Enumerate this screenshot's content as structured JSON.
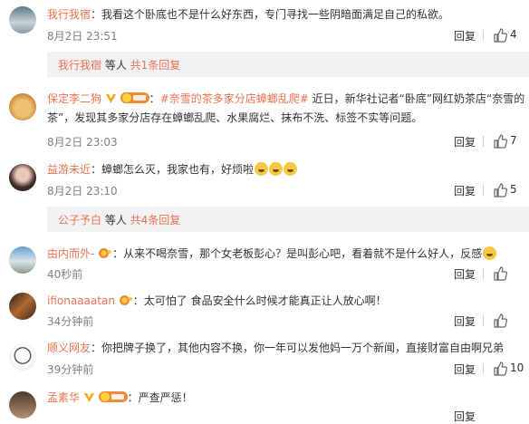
{
  "comments": [
    {
      "user": "我行我宿",
      "text": "：我看这个卧底也不是什么好东西，专门寻找一些阴暗面满足自己的私欲。",
      "time": "8月2日 23:51",
      "reply": "回复",
      "likes": "4",
      "sub": {
        "user": "我行我宿",
        "text": " 等人 ",
        "link": "共1条回复"
      }
    },
    {
      "user": "保定李二狗",
      "hashtag": "#奈雪的茶多家分店蟑螂乱爬#",
      "text1": " 近日，新华社记者“卧底”网红奶茶店“奈雪的",
      "text2": "茶”，发现其多家分店存在蟑螂乱爬、水果腐烂、抹布不洗、标签不实等问题。",
      "time": "8月2日 23:03",
      "reply": "回复",
      "likes": "7"
    },
    {
      "user": "益游未近",
      "text": "：蟑螂怎么灭，我家也有，好烦啦",
      "time": "8月2日 23:10",
      "reply": "回复",
      "likes": "5",
      "sub": {
        "user": "公子予白",
        "text": " 等人 ",
        "link": "共4条回复"
      }
    },
    {
      "user": "由内而外-",
      "text": "：从来不喝奈雪，那个女老板彭心？是叫彭心吧，看着就不是什么好人，反感",
      "time": "40秒前",
      "reply": "回复",
      "likes": ""
    },
    {
      "user": "ifionaaaatan",
      "text": "：太可怕了 食品安全什么时候才能真正让人放心啊！",
      "time": "34分钟前",
      "reply": "回复",
      "likes": ""
    },
    {
      "user": "顺义网友",
      "text": "：你把牌子换了，其他内容不换，你一年可以发他妈一万个新闻，直接财富自由啊兄弟",
      "time": "39分钟前",
      "reply": "回复",
      "likes": "10"
    },
    {
      "user": "孟素华",
      "text": "：严查严惩！",
      "time": "",
      "reply": "回复",
      "likes": ""
    }
  ],
  "colors": {
    "link": "#eb7350",
    "muted": "#808080",
    "sub_bg": "#f2f2f5"
  },
  "icons": [
    "thumb-up-icon",
    "vip-badge-icon",
    "fan-badge-icon",
    "laugh-cry-emoji"
  ]
}
